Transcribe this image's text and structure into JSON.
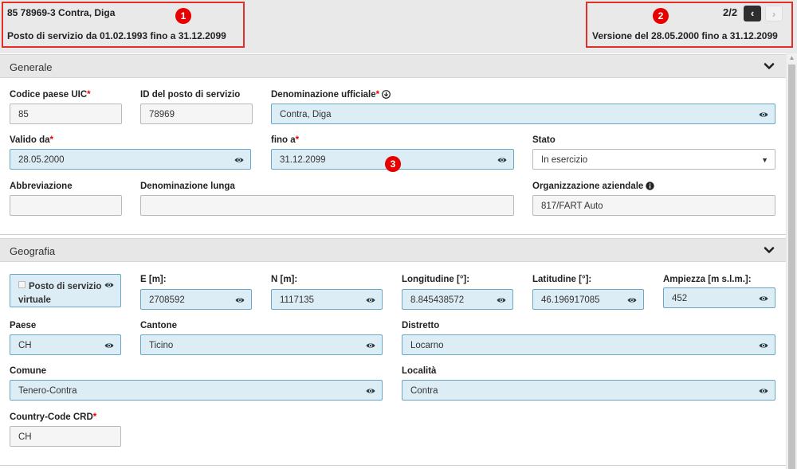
{
  "header": {
    "title": "85 78969-3 Contra, Diga",
    "validity": "Posto di servizio da 01.02.1993 fino a 31.12.2099",
    "version": "Versione del 28.05.2000 fino a 31.12.2099",
    "pager": {
      "count": "2/2",
      "prev_icon": "‹",
      "next_icon": "›"
    }
  },
  "badges": {
    "b1": "1",
    "b2": "2",
    "b3": "3"
  },
  "required_mark": "*",
  "generale": {
    "title": "Generale",
    "codice_label": "Codice paese UIC",
    "codice_value": "85",
    "id_label": "ID del posto di servizio",
    "id_value": "78969",
    "denom_label": "Denominazione ufficiale",
    "denom_value": "Contra, Diga",
    "valido_label": "Valido da",
    "valido_value": "28.05.2000",
    "fino_label": "fino a",
    "fino_value": "31.12.2099",
    "stato_label": "Stato",
    "stato_value": "In esercizio",
    "abbr_label": "Abbreviazione",
    "abbr_value": "",
    "denlunga_label": "Denominazione lunga",
    "denlunga_value": "",
    "org_label": "Organizzazione aziendale",
    "org_value": "817/FART Auto"
  },
  "geografia": {
    "title": "Geografia",
    "virtuale_label": "Posto di servizio virtuale",
    "e_label": "E [m]:",
    "e_value": "2708592",
    "n_label": "N [m]:",
    "n_value": "1117135",
    "lon_label": "Longitudine [°]:",
    "lon_value": "8.845438572",
    "lat_label": "Latitudine [°]:",
    "lat_value": "46.196917085",
    "amp_label": "Ampiezza [m s.l.m.]:",
    "amp_value": "452",
    "paese_label": "Paese",
    "paese_value": "CH",
    "cantone_label": "Cantone",
    "cantone_value": "Ticino",
    "distretto_label": "Distretto",
    "distretto_value": "Locarno",
    "comune_label": "Comune",
    "comune_value": "Tenero-Contra",
    "localita_label": "Località",
    "localita_value": "Contra",
    "crd_label": "Country-Code CRD",
    "crd_value": "CH"
  },
  "colors": {
    "annotation": "#e0302a",
    "field_blue": "#dcedf6",
    "required": "#e00000"
  }
}
